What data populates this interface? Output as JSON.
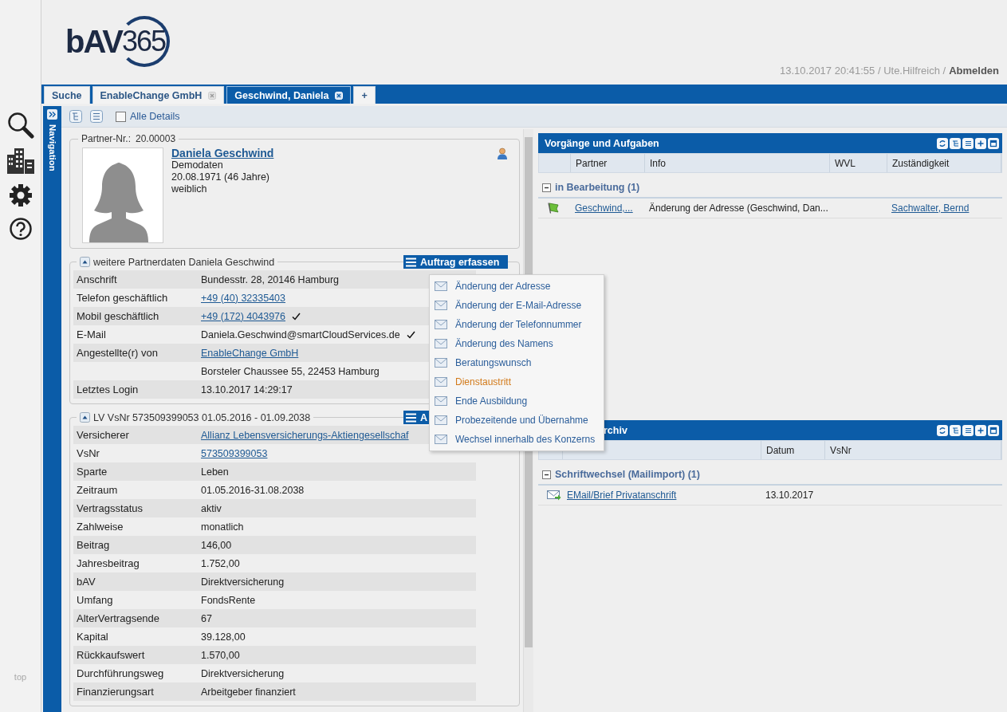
{
  "sidebar": {
    "footer_text": "top"
  },
  "header": {
    "logo": {
      "prefix": "bAV",
      "number": "365"
    },
    "session": "13.10.2017 20:41:55 / Ute.Hilfreich /",
    "logout": "Abmelden"
  },
  "tabs": [
    {
      "label": "Suche",
      "closable": false,
      "selected": false
    },
    {
      "label": "EnableChange GmbH",
      "closable": true,
      "selected": false
    },
    {
      "label": "Geschwind, Daniela",
      "closable": true,
      "selected": true
    },
    {
      "label": "+",
      "closable": false,
      "selected": false
    }
  ],
  "navigation": {
    "label": "Navigation"
  },
  "toolbar": {
    "all_details": {
      "label": "Alle Details",
      "checked": false
    }
  },
  "partner": {
    "number_label": "Partner-Nr.:",
    "number": "20.00003",
    "name": "Daniela Geschwind",
    "note": "Demodaten",
    "birth": "20.08.1971 (46 Jahre)",
    "gender": "weiblich"
  },
  "sections": [
    {
      "title": "weitere Partnerdaten Daniela Geschwind",
      "expanded": true,
      "action": "Auftrag erfassen",
      "rows": [
        {
          "label": "Anschrift",
          "value": "Bundesstr. 28, 20146 Hamburg",
          "link": false,
          "verified": false
        },
        {
          "label": "Telefon geschäftlich",
          "value": "+49 (40) 32335403",
          "link": true,
          "verified": false
        },
        {
          "label": "Mobil geschäftlich",
          "value": "+49 (172) 4043976",
          "link": true,
          "verified": true
        },
        {
          "label": "E-Mail",
          "value": "Daniela.Geschwind@smartCloudServices.de",
          "link": false,
          "verified": true
        },
        {
          "label": "Angestellte(r) von",
          "value": "EnableChange GmbH",
          "link": true,
          "verified": false
        },
        {
          "value": "Borsteler Chaussee 55, 22453 Hamburg",
          "link": false,
          "verified": false
        },
        {
          "label": "Letztes Login",
          "value": "13.10.2017 14:29:17",
          "link": false,
          "verified": false
        }
      ]
    },
    {
      "title": "LV VsNr 573509399053 01.05.2016 - 01.09.2038",
      "expanded": true,
      "action": "A",
      "rows": [
        {
          "label": "Versicherer",
          "value": "Allianz Lebensversicherungs-Aktiengesellschaf",
          "link": true,
          "verified": false
        },
        {
          "label": "VsNr",
          "value": "573509399053",
          "link": true,
          "verified": false
        },
        {
          "label": "Sparte",
          "value": "Leben",
          "link": false,
          "verified": false
        },
        {
          "label": "Zeitraum",
          "value": "01.05.2016-31.08.2038",
          "link": false,
          "verified": false
        },
        {
          "label": "Vertragsstatus",
          "value": "aktiv",
          "link": false,
          "verified": false
        },
        {
          "label": "Zahlweise",
          "value": "monatlich",
          "link": false,
          "verified": false
        },
        {
          "label": "Beitrag",
          "value": "146,00",
          "link": false,
          "verified": false
        },
        {
          "label": "Jahresbeitrag",
          "value": "1.752,00",
          "link": false,
          "verified": false
        },
        {
          "label": "bAV",
          "value": "Direktversicherung",
          "link": false,
          "verified": false
        },
        {
          "label": "Umfang",
          "value": "FondsRente",
          "link": false,
          "verified": false
        },
        {
          "label": "AlterVertragsende",
          "value": "67",
          "link": false,
          "verified": false
        },
        {
          "label": "Kapital",
          "value": "39.128,00",
          "link": false,
          "verified": false
        },
        {
          "label": "Rückkaufswert",
          "value": "1.570,00",
          "link": false,
          "verified": false
        },
        {
          "label": "Durchführungsweg",
          "value": "Direktversicherung",
          "link": false,
          "verified": false
        },
        {
          "label": "Finanzierungsart",
          "value": "Arbeitgeber finanziert",
          "link": false,
          "verified": false
        }
      ]
    }
  ],
  "menu": {
    "items": [
      {
        "label": "Änderung der Adresse",
        "highlighted": false
      },
      {
        "label": "Änderung der E-Mail-Adresse",
        "highlighted": false
      },
      {
        "label": "Änderung der Telefonnummer",
        "highlighted": false
      },
      {
        "label": "Änderung des Namens",
        "highlighted": false
      },
      {
        "label": "Beratungswunsch",
        "highlighted": false
      },
      {
        "label": "Dienstaustritt",
        "highlighted": true
      },
      {
        "label": "Ende Ausbildung",
        "highlighted": false
      },
      {
        "label": "Probezeitende und Übernahme",
        "highlighted": false
      },
      {
        "label": "Wechsel innerhalb des Konzerns",
        "highlighted": false
      }
    ]
  },
  "panels": [
    {
      "title": "Vorgänge und Aufgaben",
      "columns": [
        {
          "label": "Partner"
        },
        {
          "label": "Info"
        },
        {
          "label": "WVL"
        },
        {
          "label": "Zuständigkeit"
        }
      ],
      "groups": [
        {
          "label": "in Bearbeitung (1)",
          "expanded": true,
          "rows": [
            {
              "kind": "task",
              "partner": {
                "text": "Geschwind,...",
                "link": true
              },
              "info": {
                "text": "Änderung der Adresse (Geschwind, Dan...",
                "link": false
              },
              "owner": {
                "text": "Sachwalter, Bernd",
                "link": true
              }
            }
          ]
        }
      ]
    },
    {
      "title": "rchiv",
      "columns": [
        {
          "label": "Datum"
        },
        {
          "label": "VsNr"
        }
      ],
      "groups": [
        {
          "label": "Schriftwechsel (Mailimport) (1)",
          "expanded": true,
          "rows": [
            {
              "kind": "mail",
              "document": {
                "text": "EMail/Brief Privatanschrift",
                "link": true
              },
              "date": {
                "text": "13.10.2017",
                "link": false
              }
            }
          ]
        }
      ]
    }
  ]
}
